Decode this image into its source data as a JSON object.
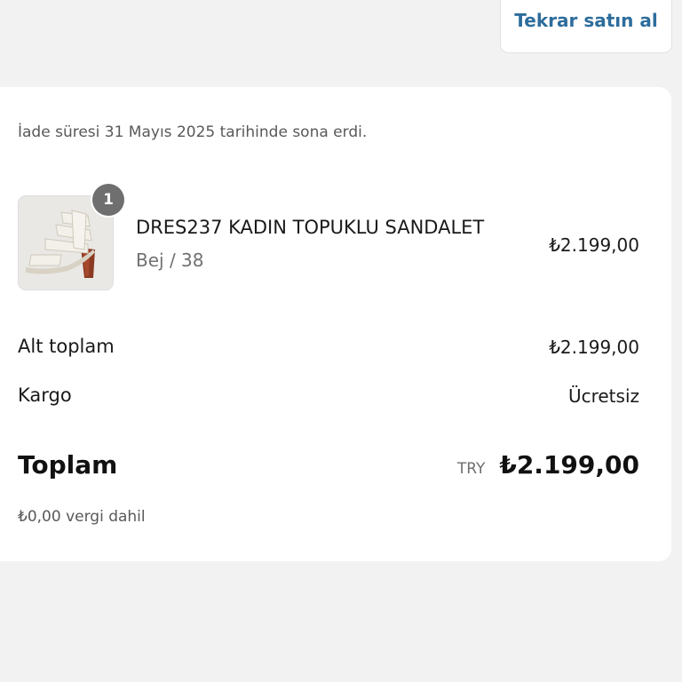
{
  "actions": {
    "reorder_label": "Tekrar satın al"
  },
  "order": {
    "return_notice": "İade süresi 31 Mayıs 2025 tarihinde sona erdi.",
    "item": {
      "name": "DRES237 KADIN TOPUKLU SANDALET",
      "variant": "Bej / 38",
      "price": "₺2.199,00",
      "quantity": "1",
      "image_icon": "sandal-product-image"
    },
    "summary": {
      "subtotal_label": "Alt toplam",
      "subtotal_value": "₺2.199,00",
      "shipping_label": "Kargo",
      "shipping_value": "Ücretsiz",
      "total_label": "Toplam",
      "currency": "TRY",
      "total_value": "₺2.199,00",
      "tax_note": "₺0,00 vergi dahil"
    }
  },
  "colors": {
    "accent": "#2d6d9c",
    "background": "#f2f2f2",
    "badge": "#6f6f6f"
  }
}
